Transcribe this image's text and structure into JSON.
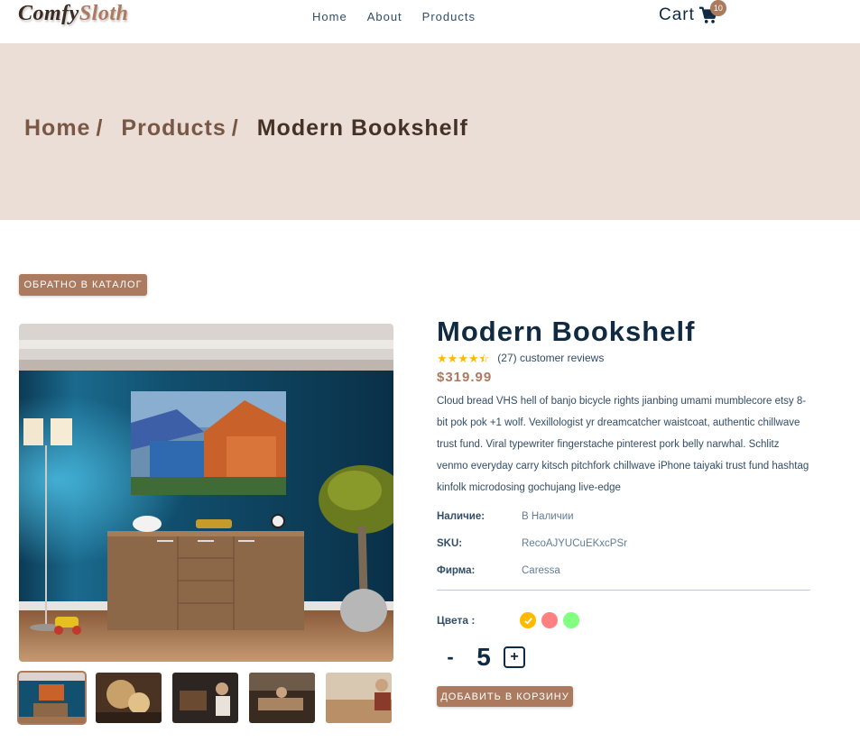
{
  "brand": {
    "part1": "Comfy",
    "part2": "Sloth"
  },
  "nav": {
    "links": [
      "Home",
      "About",
      "Products"
    ]
  },
  "cart": {
    "label": "Cart",
    "count": "10"
  },
  "breadcrumb": {
    "home": "Home",
    "products": "Products",
    "current": "Modern Bookshelf",
    "separator": "/"
  },
  "back_button": "ОБРАТНО В КАТАЛОГ",
  "product": {
    "title": "Modern Bookshelf",
    "rating": 4.5,
    "reviews": "(27) customer reviews",
    "price": "$319.99",
    "description": "Cloud bread VHS hell of banjo bicycle rights jianbing umami mumblecore etsy 8-bit pok pok +1 wolf. Vexillologist yr dreamcatcher waistcoat, authentic chillwave trust fund. Viral typewriter fingerstache pinterest pork belly narwhal. Schlitz venmo everyday carry kitsch pitchfork chillwave iPhone taiyaki trust fund hashtag kinfolk microdosing gochujang live-edge",
    "specs": [
      {
        "label": "Наличие:",
        "value": "В Наличии"
      },
      {
        "label": "SKU:",
        "value": "RecoAJYUCuEKxcPSr"
      },
      {
        "label": "Фирма:",
        "value": "Caressa"
      }
    ],
    "colors_label": "Цвета :",
    "colors": [
      "#ffb900",
      "#ff8080",
      "#80ff80"
    ],
    "selected_color": 0,
    "quantity": "5",
    "minus": "-",
    "plus": "+",
    "add_to_cart": "ДОБАВИТЬ В КОРЗИНУ",
    "thumbnail_count": 5
  },
  "colors": {
    "accent": "#ab7a5f",
    "hero_bg": "#eaded7",
    "title": "#102a42",
    "star": "#ffb900"
  }
}
